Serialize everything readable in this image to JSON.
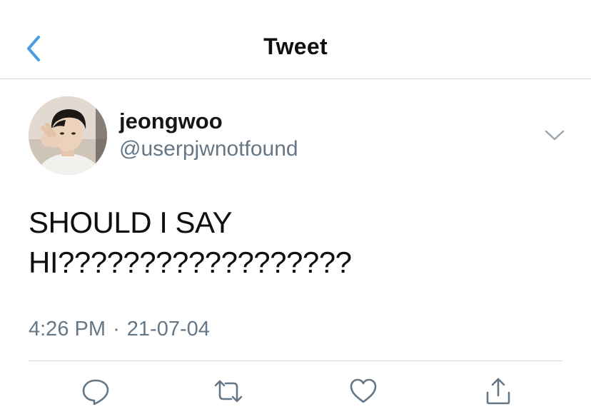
{
  "nav": {
    "title": "Tweet",
    "back_icon": "chevron-left-icon",
    "accent_color": "#4a9de4"
  },
  "tweet": {
    "author": {
      "display_name": "jeongwoo",
      "handle": "@userpjwnotfound"
    },
    "text_lines": [
      "SHOULD I SAY",
      "HI??????????????????"
    ],
    "timestamp": {
      "time": "4:26 PM",
      "separator": "·",
      "date": "21-07-04"
    },
    "actions": {
      "reply_icon": "reply-icon",
      "retweet_icon": "retweet-icon",
      "like_icon": "heart-icon",
      "share_icon": "share-icon"
    },
    "menu_icon": "chevron-down-icon"
  },
  "colors": {
    "text": "#14171a",
    "secondary": "#657786",
    "divider": "#d6d6d9",
    "icon": "#657786"
  }
}
